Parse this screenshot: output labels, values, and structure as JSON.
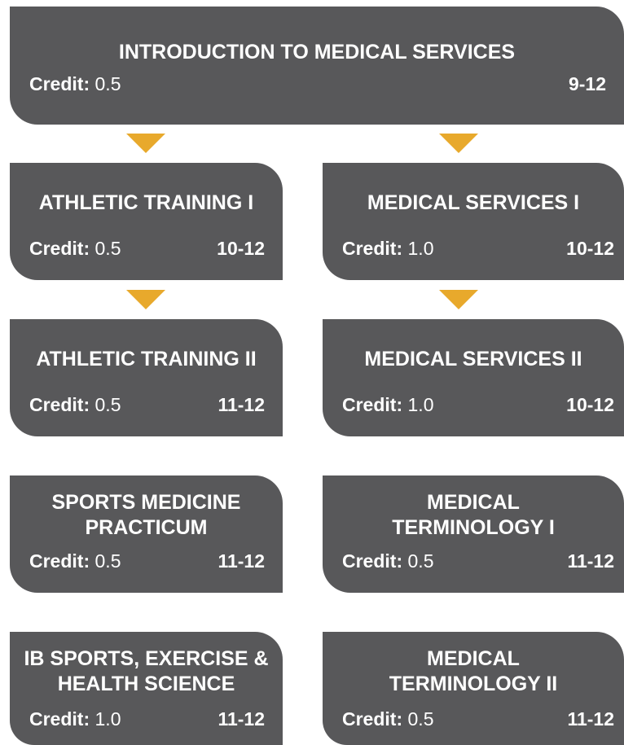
{
  "credit_label": "Credit:",
  "courses": {
    "intro": {
      "title_lines": [
        "INTRODUCTION TO MEDICAL SERVICES"
      ],
      "credit": "0.5",
      "grades": "9-12"
    },
    "athletic1": {
      "title_lines": [
        "ATHLETIC TRAINING I"
      ],
      "credit": "0.5",
      "grades": "10-12"
    },
    "medical1": {
      "title_lines": [
        "MEDICAL SERVICES I"
      ],
      "credit": "1.0",
      "grades": "10-12"
    },
    "athletic2": {
      "title_lines": [
        "ATHLETIC TRAINING II"
      ],
      "credit": "0.5",
      "grades": "11-12"
    },
    "medical2": {
      "title_lines": [
        "MEDICAL SERVICES II"
      ],
      "credit": "1.0",
      "grades": "10-12"
    },
    "practicum": {
      "title_lines": [
        "SPORTS MEDICINE",
        "PRACTICUM"
      ],
      "credit": "0.5",
      "grades": "11-12"
    },
    "terminology1": {
      "title_lines": [
        "MEDICAL",
        "TERMINOLOGY I"
      ],
      "credit": "0.5",
      "grades": "11-12"
    },
    "ib": {
      "title_lines": [
        "IB SPORTS, EXERCISE &",
        "HEALTH SCIENCE"
      ],
      "credit": "1.0",
      "grades": "11-12"
    },
    "terminology2": {
      "title_lines": [
        "MEDICAL",
        "TERMINOLOGY II"
      ],
      "credit": "0.5",
      "grades": "11-12"
    }
  },
  "colors": {
    "box": "#58585a",
    "arrow": "#e8a92c",
    "text": "#ffffff"
  }
}
